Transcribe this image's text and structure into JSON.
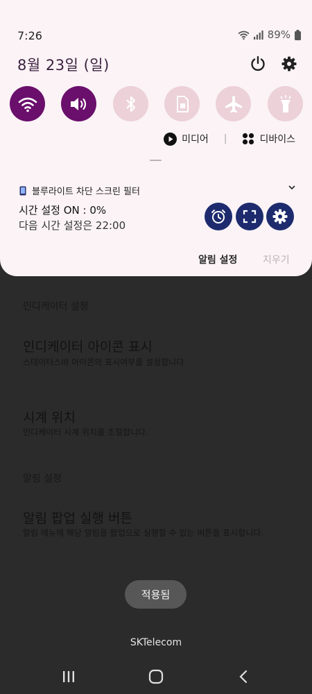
{
  "status_bar": {
    "time": "7:26",
    "battery_percent": "89%",
    "icons": [
      "wifi-icon",
      "signal-icon",
      "battery-icon"
    ]
  },
  "quick_panel": {
    "date": "8월 23일 (일)",
    "header_icons": [
      "power-icon",
      "settings-gear-icon"
    ],
    "tiles": [
      {
        "name": "wifi",
        "state": "on"
      },
      {
        "name": "sound",
        "state": "on"
      },
      {
        "name": "bluetooth",
        "state": "off"
      },
      {
        "name": "sim-card",
        "state": "off"
      },
      {
        "name": "airplane-mode",
        "state": "off"
      },
      {
        "name": "flashlight",
        "state": "off"
      }
    ],
    "media_label": "미디어",
    "devices_label": "디바이스"
  },
  "notification": {
    "app_name": "블루라이트 차단 스크린 필터",
    "title": "시간 설정 ON : 0%",
    "text": "다음 시간 설정은 22:00",
    "actions": [
      "alarm-icon",
      "fullscreen-icon",
      "gear-icon"
    ],
    "settings_label": "알림 설정",
    "clear_label": "지우기"
  },
  "background_screen": {
    "section1": "인디케이터 설정",
    "item1_title": "인디케이터 아이콘 표시",
    "item1_sub": "스테이터스바 아이콘의 표시여부를 설정합니다",
    "item2_title": "시계 위치",
    "item2_sub": "인디케이터 시계 위치를 조절합니다.",
    "section2": "알림 설정",
    "item3_title": "알림 팝업 실행 버튼",
    "item3_sub": "알림 메뉴에 해당 알림을 팝업으로 실행할 수 있는 버튼을 표시합니다."
  },
  "toast": "적용됨",
  "carrier": "SKTelecom",
  "nav_bar": [
    "recents-icon",
    "home-icon",
    "back-icon"
  ],
  "colors": {
    "panel_bg": "#fbf3f6",
    "tile_active": "#6a0f6c",
    "tile_inactive": "#ecd1d9",
    "action_button": "#1d2b6e"
  }
}
